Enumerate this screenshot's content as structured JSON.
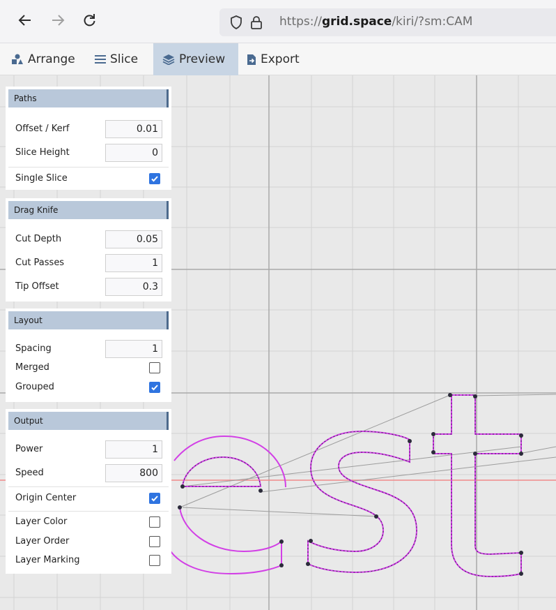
{
  "browser": {
    "url_prefix": "https://",
    "url_host": "grid.space",
    "url_path": "/kiri/?sm:CAM"
  },
  "menu": {
    "items": [
      {
        "label": "Arrange",
        "icon": "shapes-icon"
      },
      {
        "label": "Slice",
        "icon": "lines-icon"
      },
      {
        "label": "Preview",
        "icon": "layers-icon",
        "active": true
      },
      {
        "label": "Export",
        "icon": "file-export-icon"
      }
    ]
  },
  "panel": {
    "paths": {
      "title": "Paths",
      "offset_label": "Offset / Kerf",
      "offset_value": "0.01",
      "slice_height_label": "Slice Height",
      "slice_height_value": "0",
      "single_slice_label": "Single Slice",
      "single_slice_checked": true
    },
    "drag_knife": {
      "title": "Drag Knife",
      "cut_depth_label": "Cut Depth",
      "cut_depth_value": "0.05",
      "cut_passes_label": "Cut Passes",
      "cut_passes_value": "1",
      "tip_offset_label": "Tip Offset",
      "tip_offset_value": "0.3"
    },
    "layout": {
      "title": "Layout",
      "spacing_label": "Spacing",
      "spacing_value": "1",
      "merged_label": "Merged",
      "merged_checked": false,
      "grouped_label": "Grouped",
      "grouped_checked": true
    },
    "output": {
      "title": "Output",
      "power_label": "Power",
      "power_value": "1",
      "speed_label": "Speed",
      "speed_value": "800",
      "origin_center_label": "Origin Center",
      "origin_center_checked": true,
      "layer_color_label": "Layer Color",
      "layer_color_checked": false,
      "layer_order_label": "Layer Order",
      "layer_order_checked": false,
      "layer_marking_label": "Layer Marking",
      "layer_marking_checked": false
    }
  },
  "colors": {
    "accent": "#2f74e0",
    "group_header": "#b9c8da",
    "active_tab": "#c8d5e4",
    "toolpath": "#d23fe6",
    "origin_line": "#f08a8a"
  }
}
